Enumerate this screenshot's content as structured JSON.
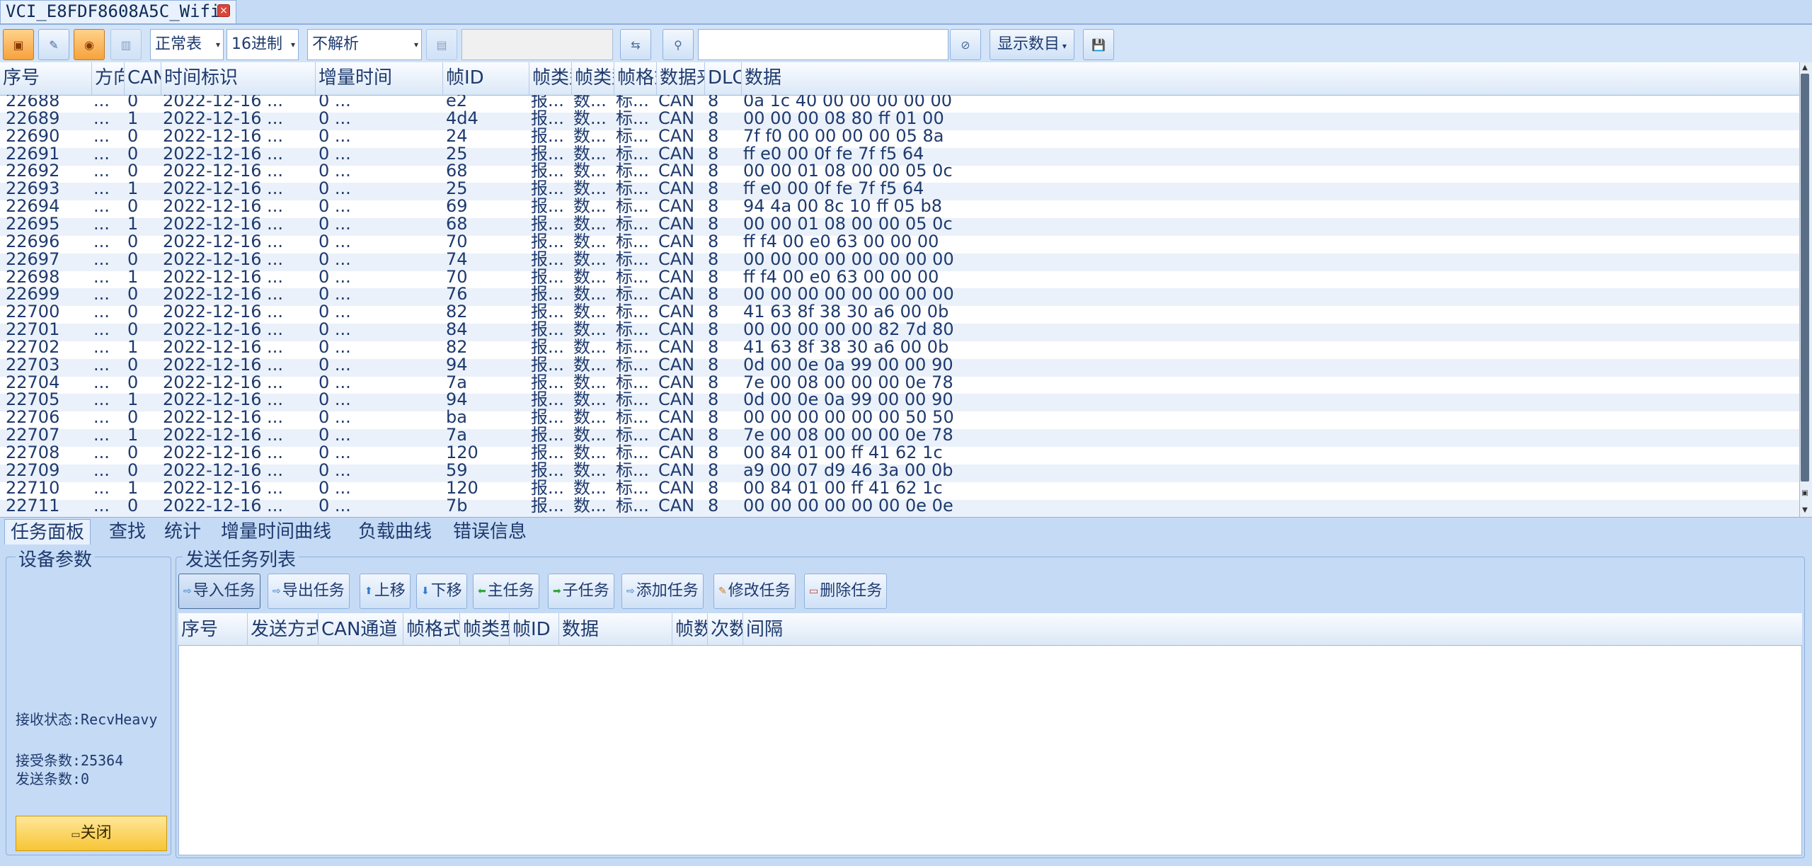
{
  "window": {
    "tab_title": "VCI_E8FDF8608A5C_Wifi",
    "close_glyph": "×"
  },
  "toolbar": {
    "table_mode": "正常表",
    "radix": "16进制",
    "parse_mode": "不解析",
    "filter_value": "",
    "display_count_label": "显示数目"
  },
  "grid": {
    "headers": [
      "序号",
      "方向",
      "CAN",
      "时间标识",
      "增量时间",
      "帧ID",
      "帧类型",
      "帧类型",
      "帧格式",
      "数据来源",
      "DLC",
      "数据"
    ],
    "rows": [
      [
        "22688",
        "...",
        "0",
        "2022-12-16 ...",
        "0 ...",
        "e2",
        "报...",
        "数...",
        "标...",
        "CAN",
        "8",
        "0a 1c 40 00 00 00 00 00"
      ],
      [
        "22689",
        "...",
        "1",
        "2022-12-16 ...",
        "0 ...",
        "4d4",
        "报...",
        "数...",
        "标...",
        "CAN",
        "8",
        "00 00 00 08 80 ff 01 00"
      ],
      [
        "22690",
        "...",
        "0",
        "2022-12-16 ...",
        "0 ...",
        "24",
        "报...",
        "数...",
        "标...",
        "CAN",
        "8",
        "7f f0 00 00 00 00 05 8a"
      ],
      [
        "22691",
        "...",
        "0",
        "2022-12-16 ...",
        "0 ...",
        "25",
        "报...",
        "数...",
        "标...",
        "CAN",
        "8",
        "ff e0 00 0f fe 7f f5 64"
      ],
      [
        "22692",
        "...",
        "0",
        "2022-12-16 ...",
        "0 ...",
        "68",
        "报...",
        "数...",
        "标...",
        "CAN",
        "8",
        "00 00 01 08 00 00 05 0c"
      ],
      [
        "22693",
        "...",
        "1",
        "2022-12-16 ...",
        "0 ...",
        "25",
        "报...",
        "数...",
        "标...",
        "CAN",
        "8",
        "ff e0 00 0f fe 7f f5 64"
      ],
      [
        "22694",
        "...",
        "0",
        "2022-12-16 ...",
        "0 ...",
        "69",
        "报...",
        "数...",
        "标...",
        "CAN",
        "8",
        "94 4a 00 8c 10 ff 05 b8"
      ],
      [
        "22695",
        "...",
        "1",
        "2022-12-16 ...",
        "0 ...",
        "68",
        "报...",
        "数...",
        "标...",
        "CAN",
        "8",
        "00 00 01 08 00 00 05 0c"
      ],
      [
        "22696",
        "...",
        "0",
        "2022-12-16 ...",
        "0 ...",
        "70",
        "报...",
        "数...",
        "标...",
        "CAN",
        "8",
        "ff f4 00 e0 63 00 00 00"
      ],
      [
        "22697",
        "...",
        "0",
        "2022-12-16 ...",
        "0 ...",
        "74",
        "报...",
        "数...",
        "标...",
        "CAN",
        "8",
        "00 00 00 00 00 00 00 00"
      ],
      [
        "22698",
        "...",
        "1",
        "2022-12-16 ...",
        "0 ...",
        "70",
        "报...",
        "数...",
        "标...",
        "CAN",
        "8",
        "ff f4 00 e0 63 00 00 00"
      ],
      [
        "22699",
        "...",
        "0",
        "2022-12-16 ...",
        "0 ...",
        "76",
        "报...",
        "数...",
        "标...",
        "CAN",
        "8",
        "00 00 00 00 00 00 00 00"
      ],
      [
        "22700",
        "...",
        "0",
        "2022-12-16 ...",
        "0 ...",
        "82",
        "报...",
        "数...",
        "标...",
        "CAN",
        "8",
        "41 63 8f 38 30 a6 00 0b"
      ],
      [
        "22701",
        "...",
        "0",
        "2022-12-16 ...",
        "0 ...",
        "84",
        "报...",
        "数...",
        "标...",
        "CAN",
        "8",
        "00 00 00 00 00 82 7d 80"
      ],
      [
        "22702",
        "...",
        "1",
        "2022-12-16 ...",
        "0 ...",
        "82",
        "报...",
        "数...",
        "标...",
        "CAN",
        "8",
        "41 63 8f 38 30 a6 00 0b"
      ],
      [
        "22703",
        "...",
        "0",
        "2022-12-16 ...",
        "0 ...",
        "94",
        "报...",
        "数...",
        "标...",
        "CAN",
        "8",
        "0d 00 0e 0a 99 00 00 90"
      ],
      [
        "22704",
        "...",
        "0",
        "2022-12-16 ...",
        "0 ...",
        "7a",
        "报...",
        "数...",
        "标...",
        "CAN",
        "8",
        "7e 00 08 00 00 00 0e 78"
      ],
      [
        "22705",
        "...",
        "1",
        "2022-12-16 ...",
        "0 ...",
        "94",
        "报...",
        "数...",
        "标...",
        "CAN",
        "8",
        "0d 00 0e 0a 99 00 00 90"
      ],
      [
        "22706",
        "...",
        "0",
        "2022-12-16 ...",
        "0 ...",
        "ba",
        "报...",
        "数...",
        "标...",
        "CAN",
        "8",
        "00 00 00 00 00 00 50 50"
      ],
      [
        "22707",
        "...",
        "1",
        "2022-12-16 ...",
        "0 ...",
        "7a",
        "报...",
        "数...",
        "标...",
        "CAN",
        "8",
        "7e 00 08 00 00 00 0e 78"
      ],
      [
        "22708",
        "...",
        "0",
        "2022-12-16 ...",
        "0 ...",
        "120",
        "报...",
        "数...",
        "标...",
        "CAN",
        "8",
        "00 84 01 00 ff 41 62 1c"
      ],
      [
        "22709",
        "...",
        "0",
        "2022-12-16 ...",
        "0 ...",
        "59",
        "报...",
        "数...",
        "标...",
        "CAN",
        "8",
        "a9 00 07 d9 46 3a 00 0b"
      ],
      [
        "22710",
        "...",
        "1",
        "2022-12-16 ...",
        "0 ...",
        "120",
        "报...",
        "数...",
        "标...",
        "CAN",
        "8",
        "00 84 01 00 ff 41 62 1c"
      ],
      [
        "22711",
        "...",
        "0",
        "2022-12-16 ...",
        "0 ...",
        "7b",
        "报...",
        "数...",
        "标...",
        "CAN",
        "8",
        "00 00 00 00 00 00 0e 0e"
      ]
    ]
  },
  "tabs": [
    "任务面板",
    "查找",
    "统计",
    "增量时间曲线",
    "负载曲线",
    "错误信息"
  ],
  "device_panel": {
    "title": "设备参数",
    "recv_status": "接收状态:RecvHeavy",
    "recv_count": "接受条数:25364",
    "send_count": "发送条数:0",
    "close_label": "关闭"
  },
  "send_panel": {
    "title": "发送任务列表",
    "buttons": [
      "导入任务",
      "导出任务",
      "上移",
      "下移",
      "主任务",
      "子任务",
      "添加任务",
      "修改任务",
      "删除任务"
    ],
    "headers": [
      "序号",
      "发送方式",
      "CAN通道",
      "帧格式",
      "帧类型",
      "帧ID",
      "数据",
      "帧数",
      "次数",
      "间隔"
    ]
  },
  "colors": {
    "accent_orange": "#f6a23d",
    "close_button_yellow": "#f7c534",
    "header_blue": "#dbe8f7"
  }
}
